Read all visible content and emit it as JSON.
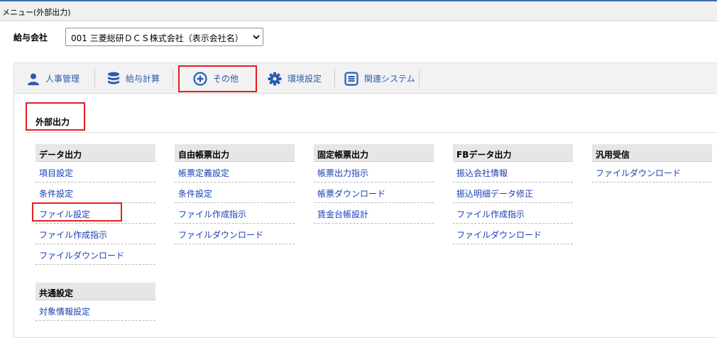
{
  "window": {
    "title": "メニュー(外部出力)"
  },
  "company": {
    "label": "給与会社",
    "selected": "001 三菱総研ＤＣＳ株式会社（表示会社名）"
  },
  "nav": [
    {
      "label": "人事管理",
      "icon": "person-icon"
    },
    {
      "label": "給与計算",
      "icon": "database-icon"
    },
    {
      "label": "その他",
      "icon": "plus-circle-icon"
    },
    {
      "label": "環境設定",
      "icon": "gear-icon"
    },
    {
      "label": "関連システム",
      "icon": "list-box-icon"
    }
  ],
  "section": {
    "title": "外部出力"
  },
  "columns": [
    {
      "title": "データ出力",
      "items": [
        "項目設定",
        "条件設定",
        "ファイル設定",
        "ファイル作成指示",
        "ファイルダウンロード"
      ]
    },
    {
      "title": "自由帳票出力",
      "items": [
        "帳票定義設定",
        "条件設定",
        "ファイル作成指示",
        "ファイルダウンロード"
      ]
    },
    {
      "title": "固定帳票出力",
      "items": [
        "帳票出力指示",
        "帳票ダウンロード",
        "賃金台帳設計"
      ]
    },
    {
      "title": "FBデータ出力",
      "items": [
        "振込会社情報",
        "振込明細データ修正",
        "ファイル作成指示",
        "ファイルダウンロード"
      ]
    },
    {
      "title": "汎用受信",
      "items": [
        "ファイルダウンロード"
      ]
    },
    {
      "title": "共通設定",
      "items": [
        "対象情報設定"
      ]
    }
  ],
  "colors": {
    "accent": "#3d6fb6",
    "link": "#1a3fb4",
    "highlight": "#e0201f"
  }
}
